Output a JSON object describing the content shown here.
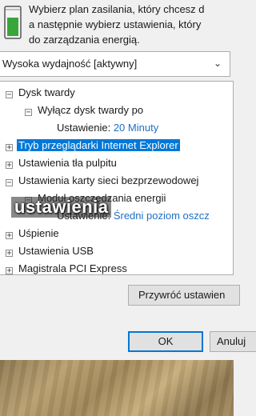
{
  "header": {
    "lines": [
      "Wybierz plan zasilania, który chcesz d",
      "a następnie wybierz ustawienia, który",
      "do zarządzania energią."
    ]
  },
  "plan_select": {
    "value": "Wysoka wydajność [aktywny]"
  },
  "tree": {
    "disk": {
      "label": "Dysk twardy",
      "child": "Wyłącz dysk twardy po",
      "setting_label": "Ustawienie:",
      "setting_value": "20 Minuty"
    },
    "ie": {
      "label": "Tryb przeglądarki Internet Explorer"
    },
    "desktop_bg": {
      "label": "Ustawienia tła pulpitu"
    },
    "wireless": {
      "label": "Ustawienia karty sieci bezprzewodowej",
      "child": "Moduł oszczędzania energii",
      "setting_label": "Ustawienie:",
      "setting_value": "Średni poziom oszcz"
    },
    "sleep": {
      "label": "Uśpienie"
    },
    "usb": {
      "label": "Ustawienia USB"
    },
    "pci": {
      "label": "Magistrala PCI Express"
    }
  },
  "overlay": {
    "caption": "ustawienia"
  },
  "buttons": {
    "restore": "Przywróć ustawien",
    "ok": "OK",
    "cancel": "Anuluj"
  },
  "colors": {
    "selection": "#0078d7",
    "link": "#1e6fc5",
    "button_face": "#e1e1e1"
  }
}
